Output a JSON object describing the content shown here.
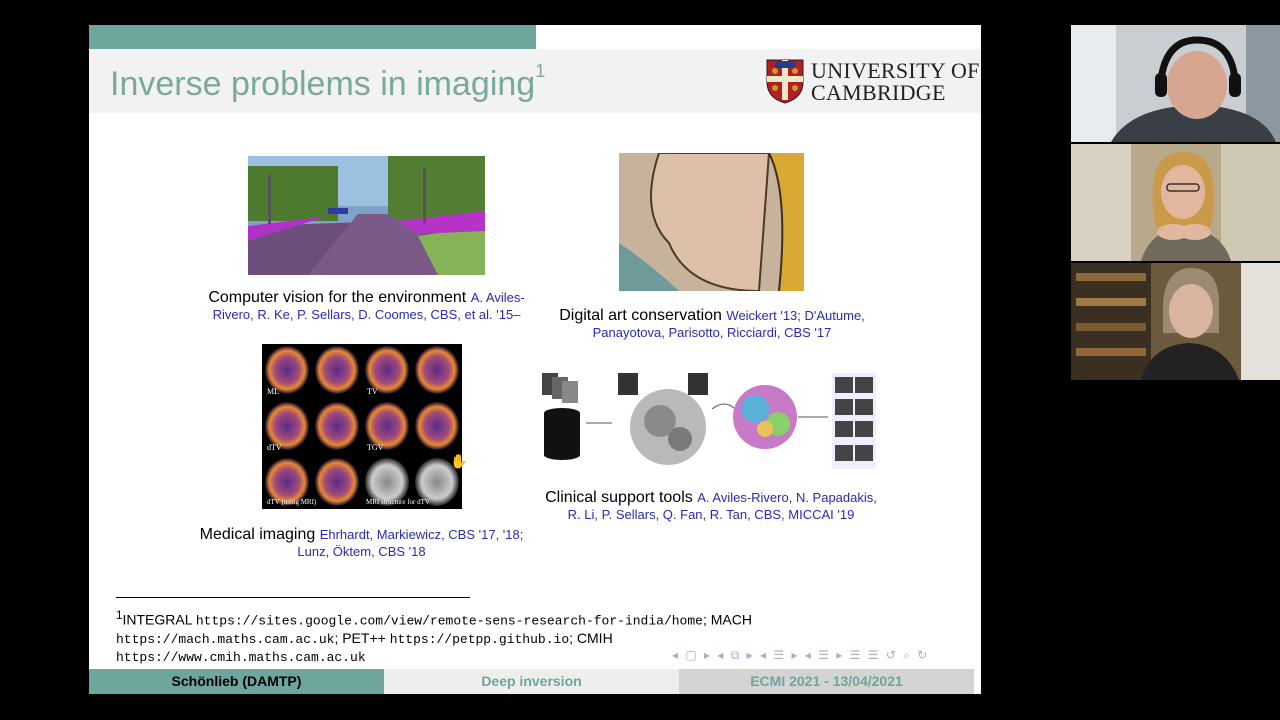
{
  "slide": {
    "title": "Inverse problems in imaging",
    "title_footnote_mark": "1",
    "logo": {
      "line1": "UNIVERSITY OF",
      "line2": "CAMBRIDGE"
    },
    "panels": {
      "cv": {
        "caption": "Computer vision for the environment",
        "cite": "A. Aviles-Rivero, R. Ke, P. Sellars, D. Coomes, CBS, et al. '15–"
      },
      "art": {
        "caption": "Digital art conservation",
        "cite": "Weickert '13; D'Autume, Panayotova, Parisotto, Ricciardi, CBS '17"
      },
      "medical": {
        "caption": "Medical imaging",
        "cite": "Ehrhardt, Markiewicz, CBS '17, '18; Lunz, Öktem, CBS '18",
        "labels": [
          "ML",
          "TV",
          "dTV",
          "TGV",
          "dTV (using MRI)",
          "MRI structure for dTV"
        ]
      },
      "clinical": {
        "caption": "Clinical support tools",
        "cite": "A. Aviles-Rivero, N. Papadakis, R. Li, P. Sellars, Q. Fan, R. Tan, CBS, MICCAI '19"
      }
    },
    "footnote": {
      "mark": "1",
      "t1": "INTEGRAL",
      "u1": "https://sites.google.com/view/remote-sens-research-for-india/home",
      "t2": "; MACH",
      "u2": "https://mach.maths.cam.ac.uk",
      "t3": "; PET++",
      "u3": "https://petpp.github.io",
      "t4": "; CMIH",
      "u4": "https://www.cmih.maths.cam.ac.uk"
    },
    "footer": {
      "author": "Schönlieb  (DAMTP)",
      "talk": "Deep inversion",
      "event": "ECMI 2021 - 13/04/2021"
    }
  },
  "colors": {
    "accent": "#6ea59d",
    "cite": "#2a2ab8"
  }
}
